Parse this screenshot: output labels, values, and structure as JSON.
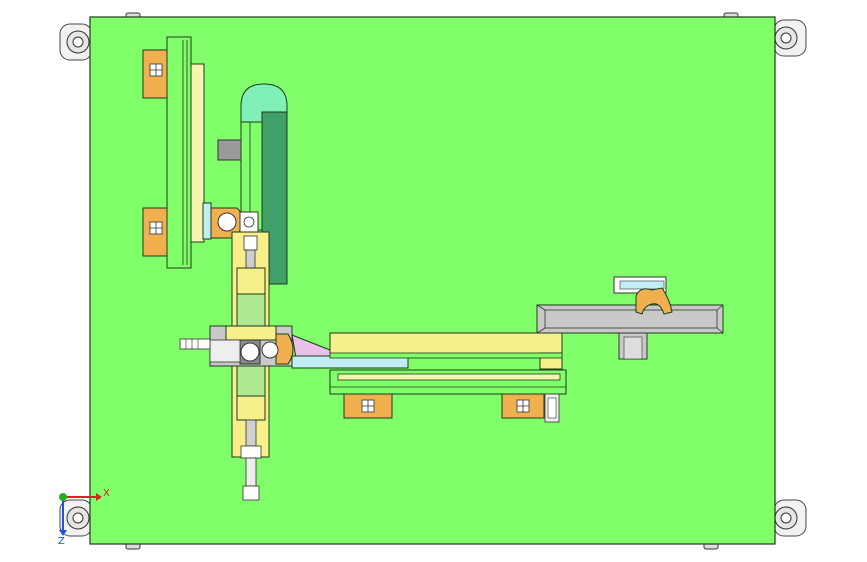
{
  "viewport": {
    "background": "#ffffff",
    "colors": {
      "plate": "#80ff6a",
      "plate_outline": "#1f3a18",
      "profile": "#f0b050",
      "yellow_part": "#f7f08a",
      "pale_yellow": "#f5f5b0",
      "dark_green": "#3fa06a",
      "mint": "#7ff0b8",
      "cylinder_green": "#aee890",
      "light_blue": "#bfeef5",
      "gray": "#c9c9c9",
      "dark_gray": "#8a8a8a",
      "pink": "#e8c0e8",
      "axis_x": "#e02020",
      "axis_y": "#20b020",
      "axis_z": "#2050e0"
    }
  },
  "coordinate_triad": {
    "x_label": "X",
    "z_label": "Z"
  }
}
